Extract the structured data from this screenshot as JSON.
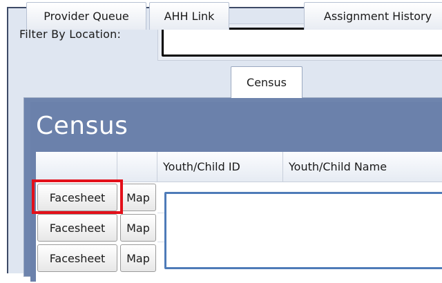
{
  "filter": {
    "label": "Filter By Location:",
    "value": ""
  },
  "tabs": [
    {
      "label": "Provider Queue",
      "active": false
    },
    {
      "label": "AHH Link",
      "active": false
    },
    {
      "label": "Census",
      "active": true
    },
    {
      "label": "Assignment History",
      "active": false
    }
  ],
  "panel": {
    "title": "Census"
  },
  "grid": {
    "columns": [
      "",
      "",
      "Youth/Child ID",
      "Youth/Child Name"
    ],
    "rows": [
      {
        "facesheet": "Facesheet",
        "map": "Map"
      },
      {
        "facesheet": "Facesheet",
        "map": "Map"
      },
      {
        "facesheet": "Facesheet",
        "map": "Map"
      }
    ]
  },
  "colors": {
    "panel": "#6e84ad",
    "highlight": "#e3101a",
    "overlay_border": "#4e7bb8"
  }
}
